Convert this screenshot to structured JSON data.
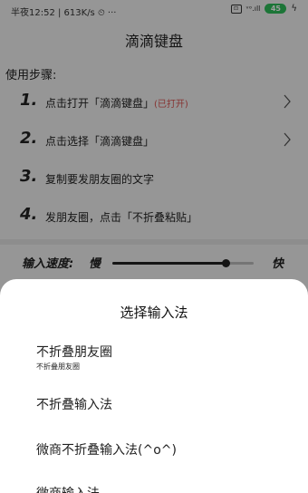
{
  "statusbar": {
    "left_text": "半夜12:52 | 613K/s ⏲ ···",
    "box_icon_text": "⊡",
    "signal_text": "ᵛᵒ.ıll",
    "battery": "45",
    "charging_glyph": "ϟ"
  },
  "navbar": {
    "title": "滴滴键盘"
  },
  "usage": {
    "label": "使用步骤:",
    "steps": [
      {
        "num": "1.",
        "text": "点击打开「滴滴键盘」",
        "note": "(已打开)"
      },
      {
        "num": "2.",
        "text": "点击选择「滴滴键盘」",
        "note": ""
      },
      {
        "num": "3.",
        "text": "复制要发朋友圈的文字",
        "note": ""
      },
      {
        "num": "4.",
        "text": "发朋友圈，点击「不折叠粘贴」",
        "note": ""
      }
    ]
  },
  "speed": {
    "label": "输入速度:",
    "slow": "慢",
    "fast": "快",
    "value_fraction": 0.8
  },
  "sheet": {
    "title": "选择输入法",
    "methods": [
      {
        "name": "不折叠朋友圈",
        "sub": "不折叠朋友圈"
      },
      {
        "name": "不折叠输入法",
        "sub": ""
      },
      {
        "name": "微商不折叠输入法(^o^)",
        "sub": ""
      },
      {
        "name": "微商输入法",
        "sub": ""
      }
    ]
  },
  "colors": {
    "accent_red": "#d9534f",
    "battery_green": "#2ebd59"
  }
}
